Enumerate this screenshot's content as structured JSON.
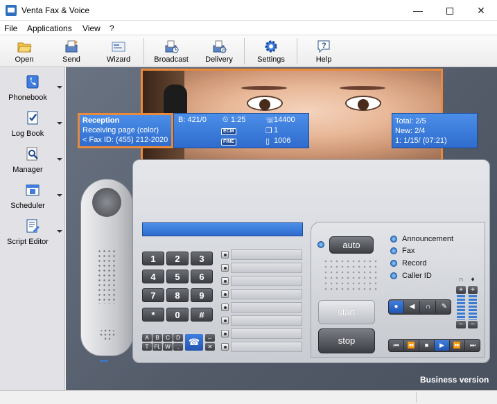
{
  "window": {
    "title": "Venta Fax & Voice",
    "minimize": "—",
    "close": "✕"
  },
  "menu": {
    "file": "File",
    "applications": "Applications",
    "view": "View",
    "help": "?"
  },
  "toolbar": {
    "open": "Open",
    "send": "Send",
    "wizard": "Wizard",
    "broadcast": "Broadcast",
    "delivery": "Delivery",
    "settings": "Settings",
    "help": "Help"
  },
  "sidebar": {
    "phonebook": "Phonebook",
    "log_book": "Log Book",
    "manager": "Manager",
    "scheduler": "Scheduler",
    "script_editor": "Script Editor"
  },
  "display": {
    "left": {
      "line1": "Reception",
      "line2": "Receiving page (color)",
      "line3": "< Fax ID: (455) 212-2020"
    },
    "mid": {
      "b": "B: 421/0",
      "time": "1:25",
      "speed": "14400",
      "ecm": "ECM",
      "fine": "FINE",
      "pages": "1",
      "size": "1006"
    },
    "right": {
      "total": "Total:  2/5",
      "new": "New: 2/4",
      "last": "1: 1/15/  (07:21)"
    }
  },
  "keypad": {
    "keys": [
      "1",
      "2",
      "3",
      "4",
      "5",
      "6",
      "7",
      "8",
      "9",
      "*",
      "0",
      "#"
    ],
    "fkeys": [
      "A",
      "B",
      "C",
      "D",
      "T",
      "FL",
      "W",
      ","
    ]
  },
  "controls": {
    "auto": "auto",
    "start": "start",
    "stop": "stop",
    "options": [
      "Announcement",
      "Fax",
      "Record",
      "Caller ID"
    ]
  },
  "edition": "Business version",
  "colors": {
    "accent_orange": "#ea8a3a",
    "display_blue": "#2f6ccd"
  }
}
